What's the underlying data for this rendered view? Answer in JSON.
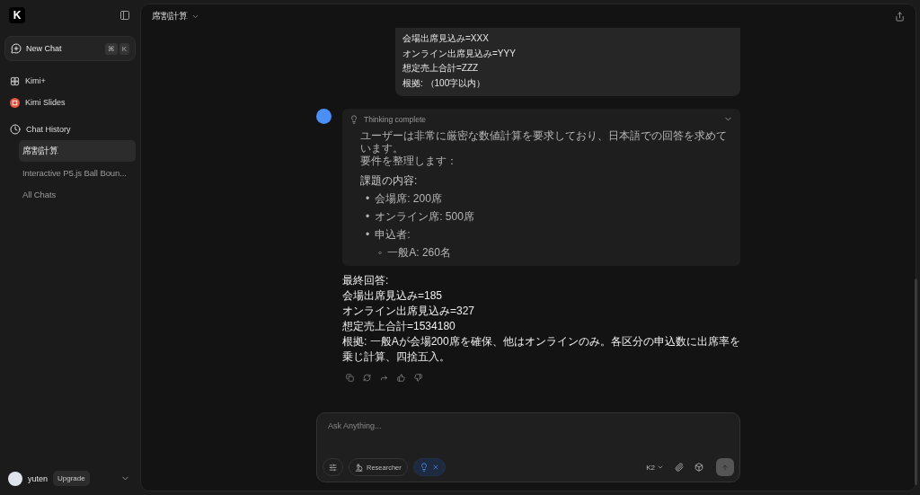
{
  "sidebar": {
    "logo": "K",
    "new_chat": {
      "label": "New Chat",
      "shortcut": [
        "⌘",
        "K"
      ]
    },
    "items": [
      {
        "kind": "plus",
        "label": "Kimi+"
      },
      {
        "kind": "slides",
        "label": "Kimi Slides"
      },
      {
        "kind": "history",
        "label": "Chat History"
      }
    ],
    "history": [
      {
        "label": "席割計算",
        "selected": true
      },
      {
        "label": "Interactive P5.js Ball Boun...",
        "selected": false
      },
      {
        "label": "All Chats",
        "selected": false
      }
    ],
    "user": {
      "name": "yuten",
      "upgrade": "Upgrade"
    }
  },
  "header": {
    "title": "席割計算"
  },
  "user_message": [
    "会場出席見込み=XXX",
    "オンライン出席見込み=YYY",
    "想定売上合計=ZZZ",
    "根拠: （100字以内）"
  ],
  "thinking": {
    "title": "Thinking complete",
    "expanded": true,
    "paragraphs": [
      "ユーザーは非常に厳密な数値計算を要求しており、日本語での回答を求めています。",
      "要件を整理します："
    ],
    "heading": "課題の内容:",
    "bullets": [
      {
        "marker": "•",
        "text": "会場席: 200席"
      },
      {
        "marker": "•",
        "text": "オンライン席: 500席"
      },
      {
        "marker": "•",
        "text": "申込者:",
        "children": [
          {
            "marker": "◦",
            "text": "一般A: 260名"
          }
        ]
      }
    ]
  },
  "answer": [
    "最終回答:",
    "会場出席見込み=185",
    "オンライン出席見込み=327",
    "想定売上合計=1534180",
    "根拠: 一般Aが会場200席を確保、他はオンラインのみ。各区分の申込数に出席率を乗じ計算、四捨五入。"
  ],
  "composer": {
    "placeholder": "Ask Anything...",
    "researcher": "Researcher",
    "thinking_on": true,
    "model": "K2"
  }
}
